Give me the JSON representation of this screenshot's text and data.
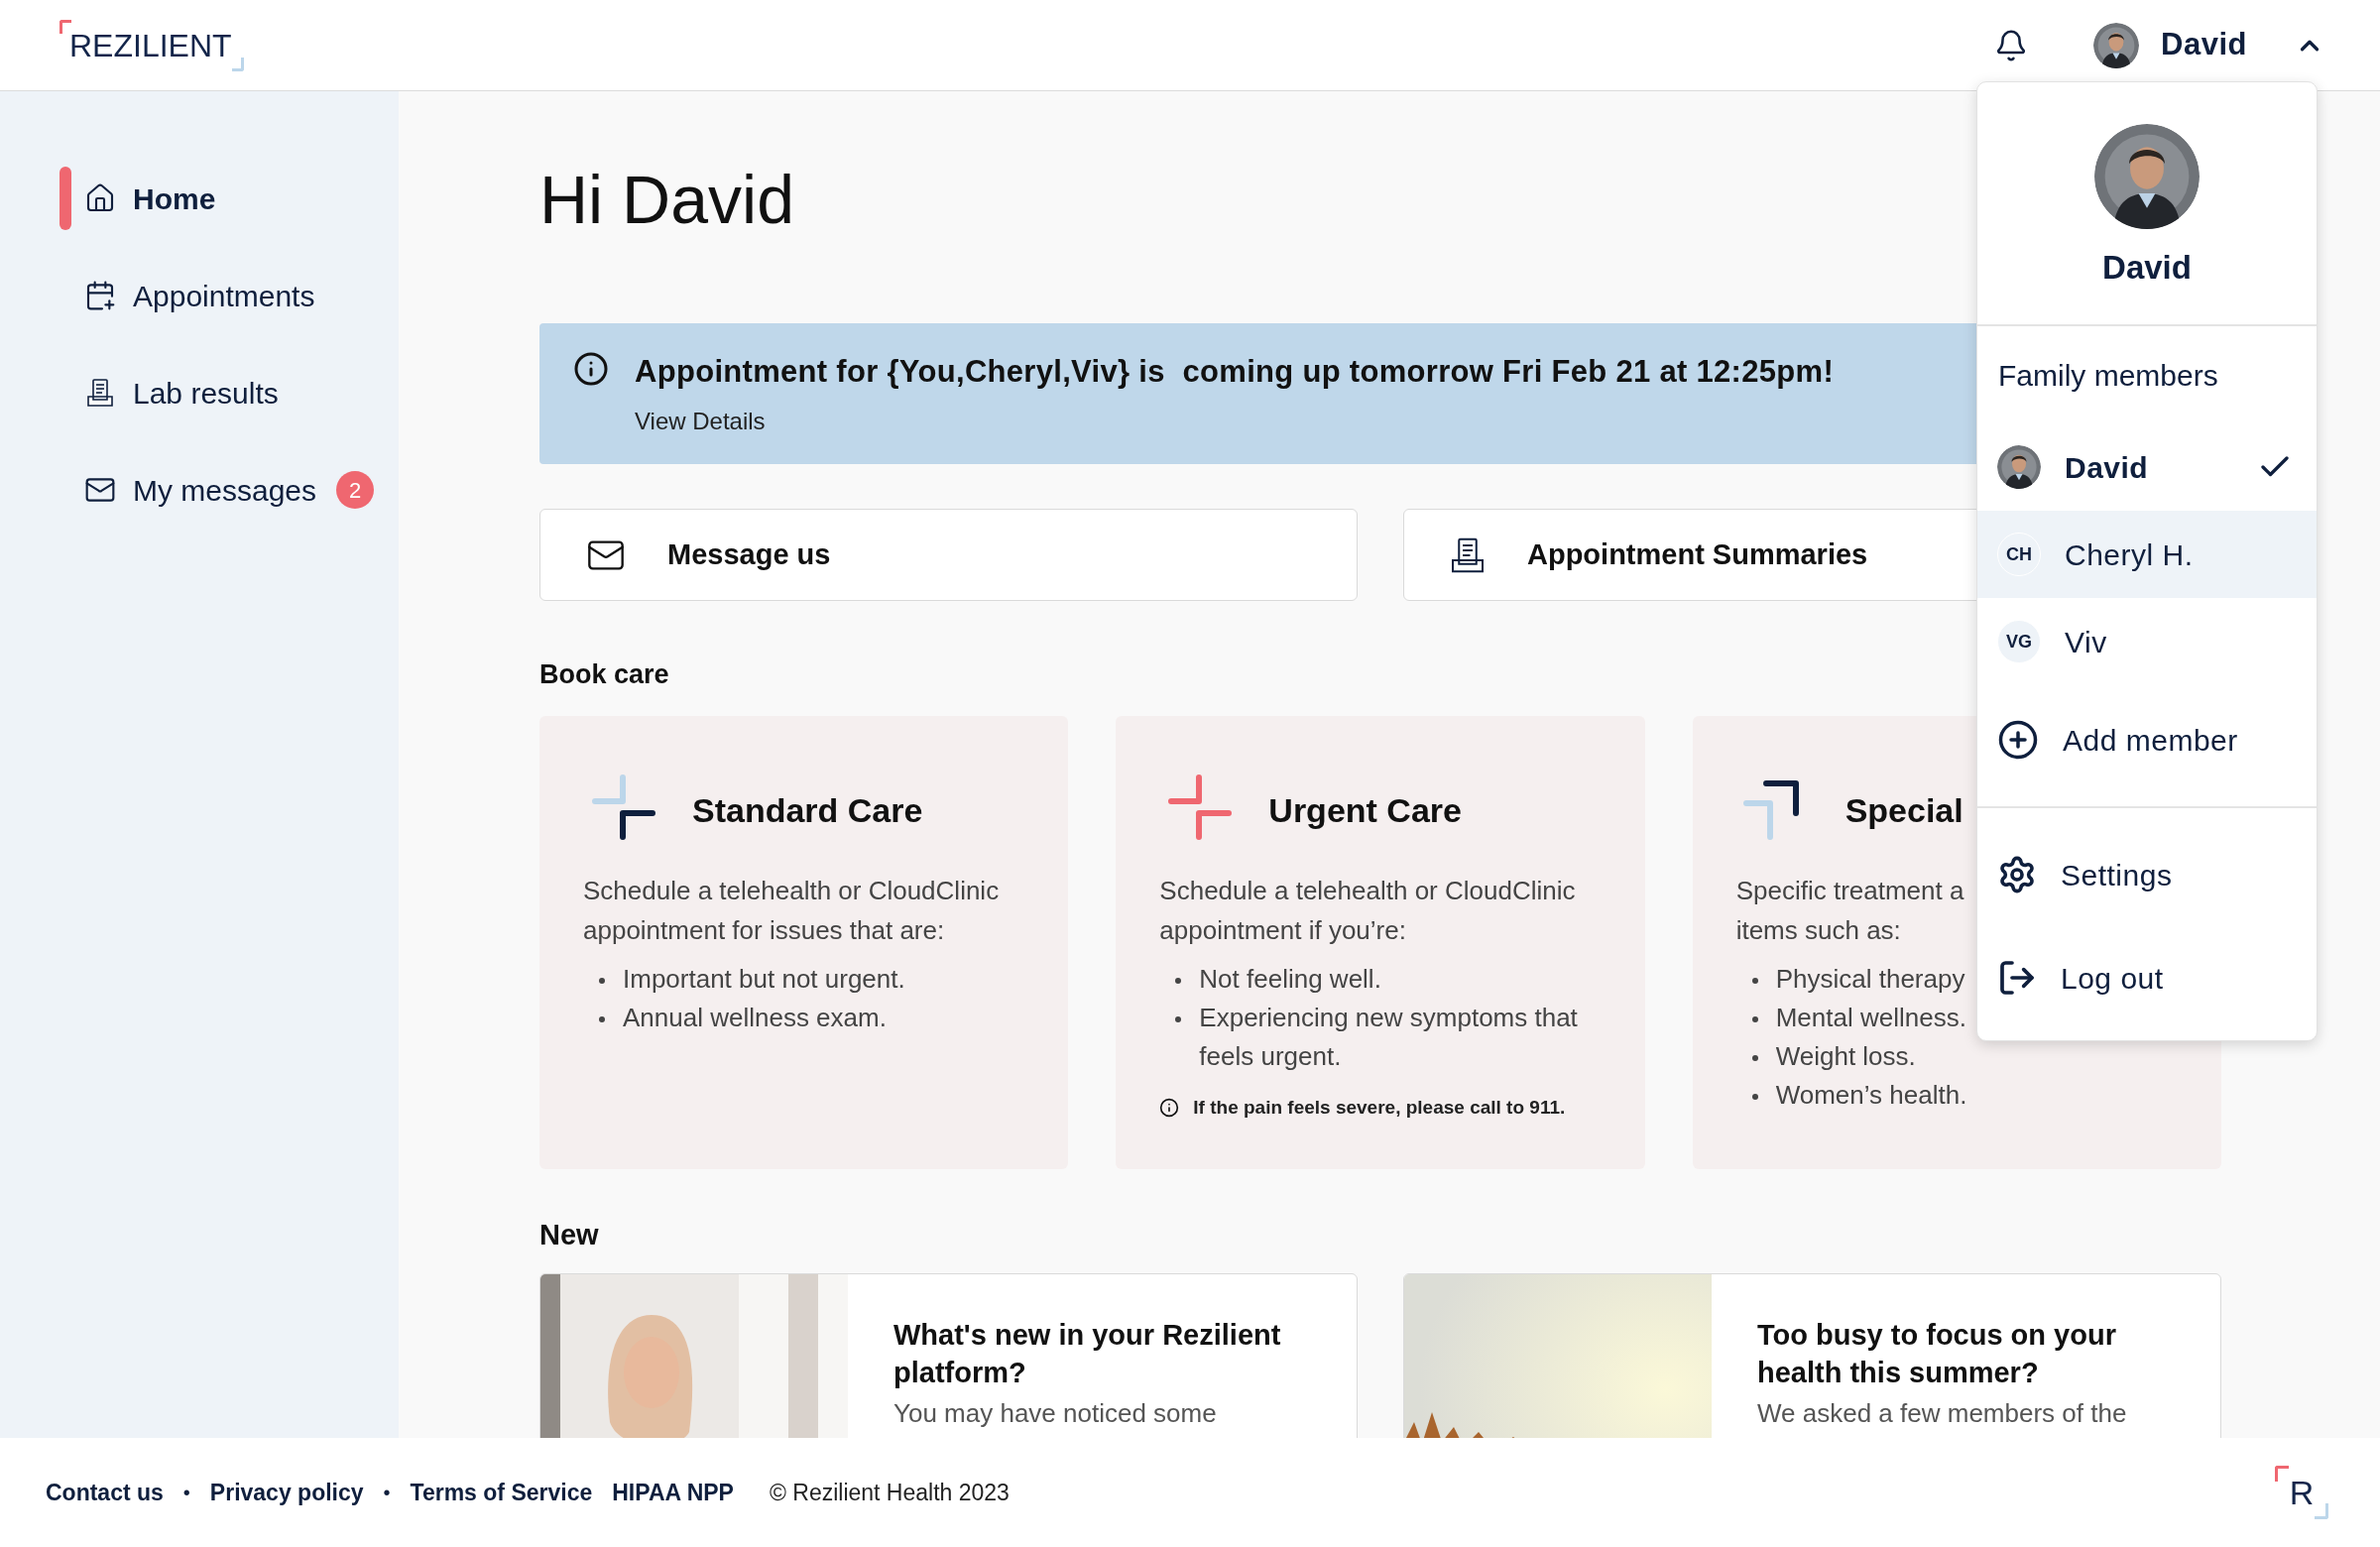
{
  "header": {
    "logo": "REZILIENT",
    "user_name": "David",
    "menu_expanded": true
  },
  "sidebar": {
    "items": [
      {
        "label": "Home",
        "selected": true
      },
      {
        "label": "Appointments",
        "selected": false
      },
      {
        "label": "Lab results",
        "selected": false
      },
      {
        "label": "My messages",
        "selected": false,
        "badge": "2"
      }
    ]
  },
  "greeting": "Hi David",
  "banner": {
    "message": "Appointment for {You,Cheryl,Viv} is  coming up tomorrow Fri Feb 21 at 12:25pm!",
    "link": "View Details"
  },
  "quick_actions": [
    {
      "label": "Message us"
    },
    {
      "label": "Appointment Summaries"
    }
  ],
  "book_care": {
    "heading": "Book care",
    "cards": [
      {
        "kind": "standard",
        "title": "Standard Care",
        "description_lines": [
          "Schedule a telehealth or CloudClinic",
          "appointment for issues that are:"
        ],
        "bullets": [
          "Important but not urgent.",
          "Annual wellness exam."
        ]
      },
      {
        "kind": "urgent",
        "title": "Urgent Care",
        "description_lines": [
          "Schedule a telehealth or CloudClinic",
          "appointment if you’re:"
        ],
        "bullets": [
          "Not feeling well.",
          "Experiencing new symptoms that feels urgent."
        ],
        "note": "If the pain feels severe, please call to 911."
      },
      {
        "kind": "specialty",
        "title": "Special",
        "description_lines": [
          "Specific treatment a",
          "items such as:"
        ],
        "bullets": [
          "Physical therapy",
          "Mental wellness.",
          "Weight loss.",
          "Women’s health."
        ]
      }
    ]
  },
  "new": {
    "heading": "New",
    "articles": [
      {
        "title": "What's new in your Rezilient platform?",
        "snippet": "You may have noticed some"
      },
      {
        "title": "Too busy to focus on your health this summer?",
        "snippet": "We asked a few members of the"
      }
    ]
  },
  "footer": {
    "items": [
      {
        "kind": "link",
        "text": "Contact us"
      },
      {
        "kind": "separator",
        "text": "•"
      },
      {
        "kind": "link",
        "text": "Privacy policy"
      },
      {
        "kind": "separator",
        "text": "•"
      },
      {
        "kind": "link",
        "text": "Terms of Service"
      },
      {
        "kind": "link",
        "text": "HIPAA NPP"
      },
      {
        "kind": "copyright",
        "text": "© Rezilient Health 2023"
      }
    ],
    "logo": "R"
  },
  "account_menu": {
    "profile_name": "David",
    "section_title": "Family members",
    "members": [
      {
        "name": "David",
        "selected": true,
        "hovered": false
      },
      {
        "name": "Cheryl H.",
        "kind": "initials",
        "initials": "CH",
        "selected": false,
        "hovered": true
      },
      {
        "name": "Viv",
        "kind": "initials",
        "initials": "VG",
        "selected": false,
        "hovered": false
      }
    ],
    "add_member": "Add member",
    "items": [
      {
        "label": "Settings"
      },
      {
        "label": "Log out"
      }
    ]
  }
}
